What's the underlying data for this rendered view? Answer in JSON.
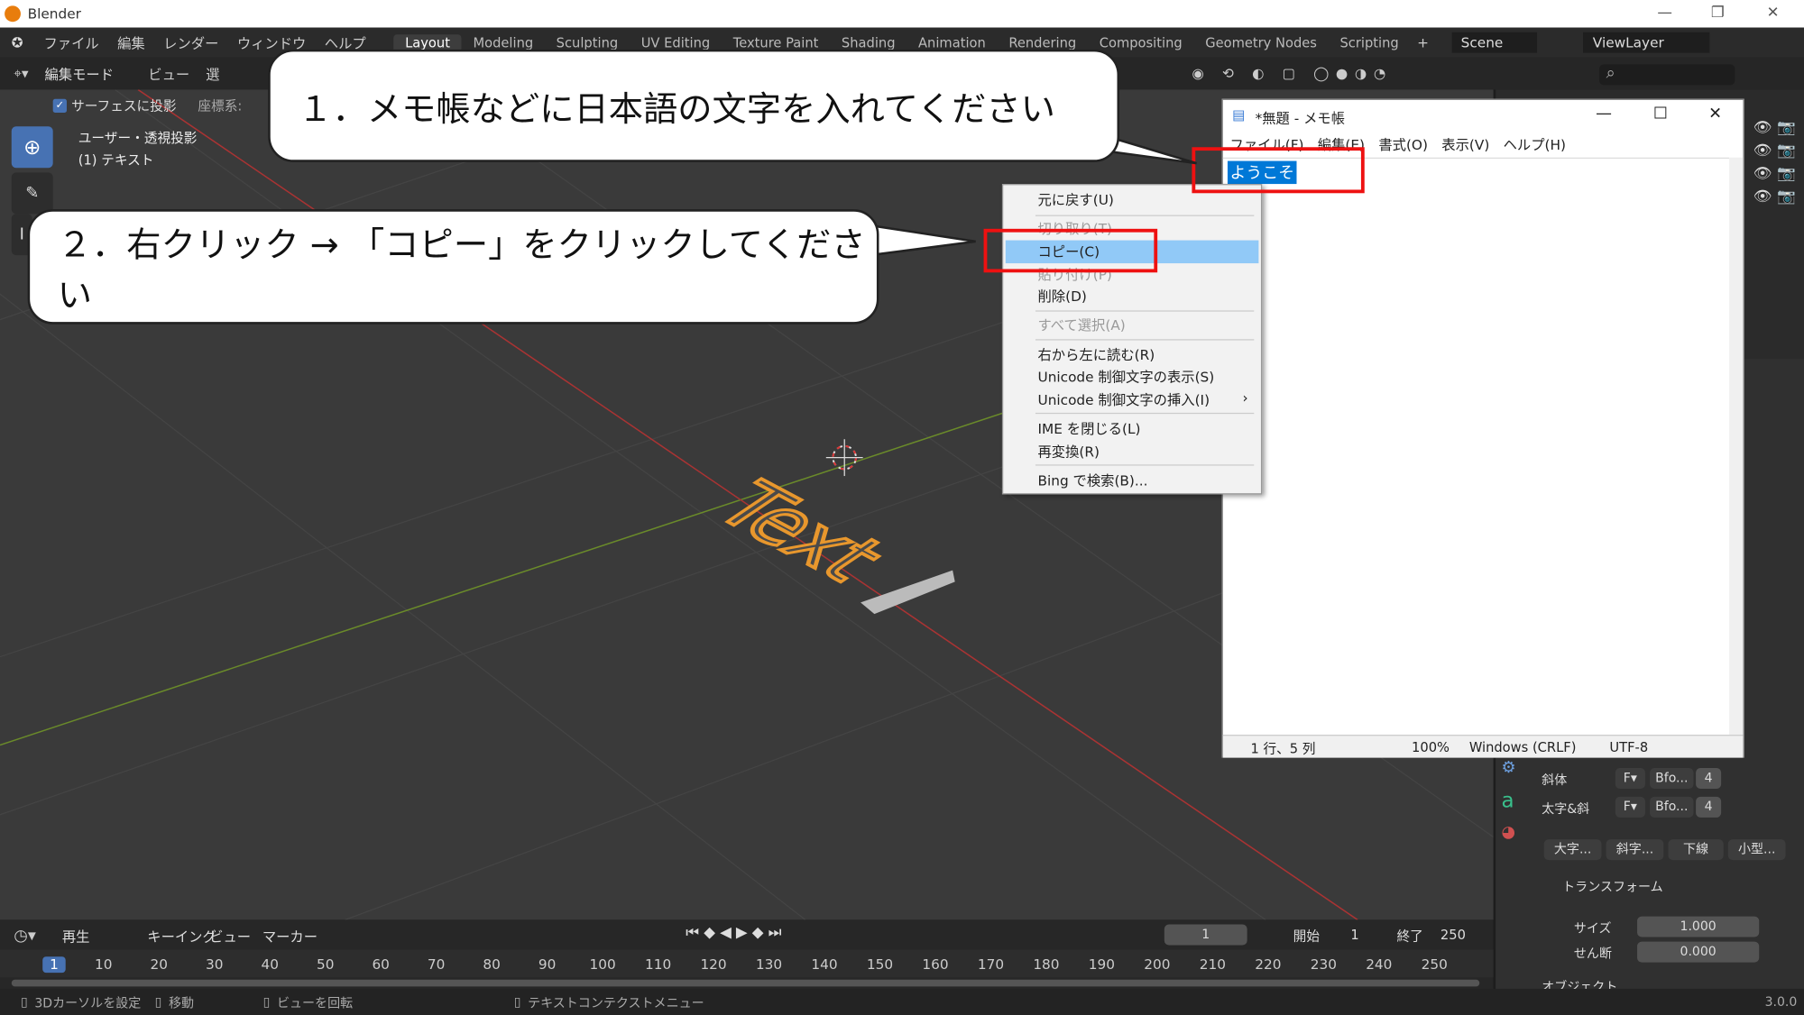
{
  "window": {
    "title": "Blender",
    "minimize": "—",
    "restore": "❐",
    "close": "✕"
  },
  "menu": [
    "ファイル",
    "編集",
    "レンダー",
    "ウィンドウ",
    "ヘルプ"
  ],
  "workspaces": [
    "Layout",
    "Modeling",
    "Sculpting",
    "UV Editing",
    "Texture Paint",
    "Shading",
    "Animation",
    "Rendering",
    "Compositing",
    "Geometry Nodes",
    "Scripting"
  ],
  "scene": "Scene",
  "view_layer": "ViewLayer",
  "header": {
    "mode": "編集モード",
    "view": "ビュー",
    "select": "選",
    "surface_project": "サーフェスに投影",
    "coord": "座標系:"
  },
  "viewport": {
    "view_name": "ユーザー・透視投影",
    "object": "(1) テキスト",
    "text_object": "Text"
  },
  "callouts": {
    "step1": "１．メモ帳などに日本語の文字を入れてください",
    "step2": "２．右クリック → 「コピー」をクリックしてください"
  },
  "notepad": {
    "title": "*無題 - メモ帳",
    "menu": [
      "ファイル(F)",
      "編集(E)",
      "書式(O)",
      "表示(V)",
      "ヘルプ(H)"
    ],
    "content": "ようこそ",
    "status": {
      "position": "1 行、5 列",
      "zoom": "100%",
      "eol": "Windows (CRLF)",
      "encoding": "UTF-8"
    }
  },
  "context_menu": {
    "undo": "元に戻す(U)",
    "cut": "切り取り(T)",
    "copy": "コピー(C)",
    "paste": "貼り付け(P)",
    "delete": "削除(D)",
    "select_all": "すべて選択(A)",
    "rtl": "右から左に読む(R)",
    "show_unicode": "Unicode 制御文字の表示(S)",
    "insert_unicode": "Unicode 制御文字の挿入(I)",
    "ime_close": "IME を閉じる(L)",
    "reconvert": "再変換(R)",
    "bing": "Bing で検索(B)...",
    "submenu_arrow": "›"
  },
  "properties": {
    "italic": "斜体",
    "bold_italic": "太字&斜",
    "font_short": "Bfo...",
    "num": "4",
    "styles": [
      "大字...",
      "斜字...",
      "下線",
      "小型..."
    ],
    "transform": "トランスフォーム",
    "size_label": "サイズ",
    "size_value": "1.000",
    "shear_label": "せん断",
    "shear_value": "0.000",
    "object_label": "オブジェクト"
  },
  "timeline": {
    "playback": "再生",
    "keying": "キーイング",
    "view": "ビュー",
    "marker": "マーカー",
    "current_frame": "1",
    "start_label": "開始",
    "start": "1",
    "end_label": "終了",
    "end": "250",
    "ticks": [
      "1",
      "10",
      "20",
      "30",
      "40",
      "50",
      "60",
      "70",
      "80",
      "90",
      "100",
      "110",
      "120",
      "130",
      "140",
      "150",
      "160",
      "170",
      "180",
      "190",
      "200",
      "210",
      "220",
      "230",
      "240",
      "250"
    ]
  },
  "status_bar": {
    "set_cursor": "3Dカーソルを設定",
    "move": "移動",
    "rotate_view": "ビューを回転",
    "text_context": "テキストコンテクストメニュー",
    "version": "3.0.0"
  }
}
